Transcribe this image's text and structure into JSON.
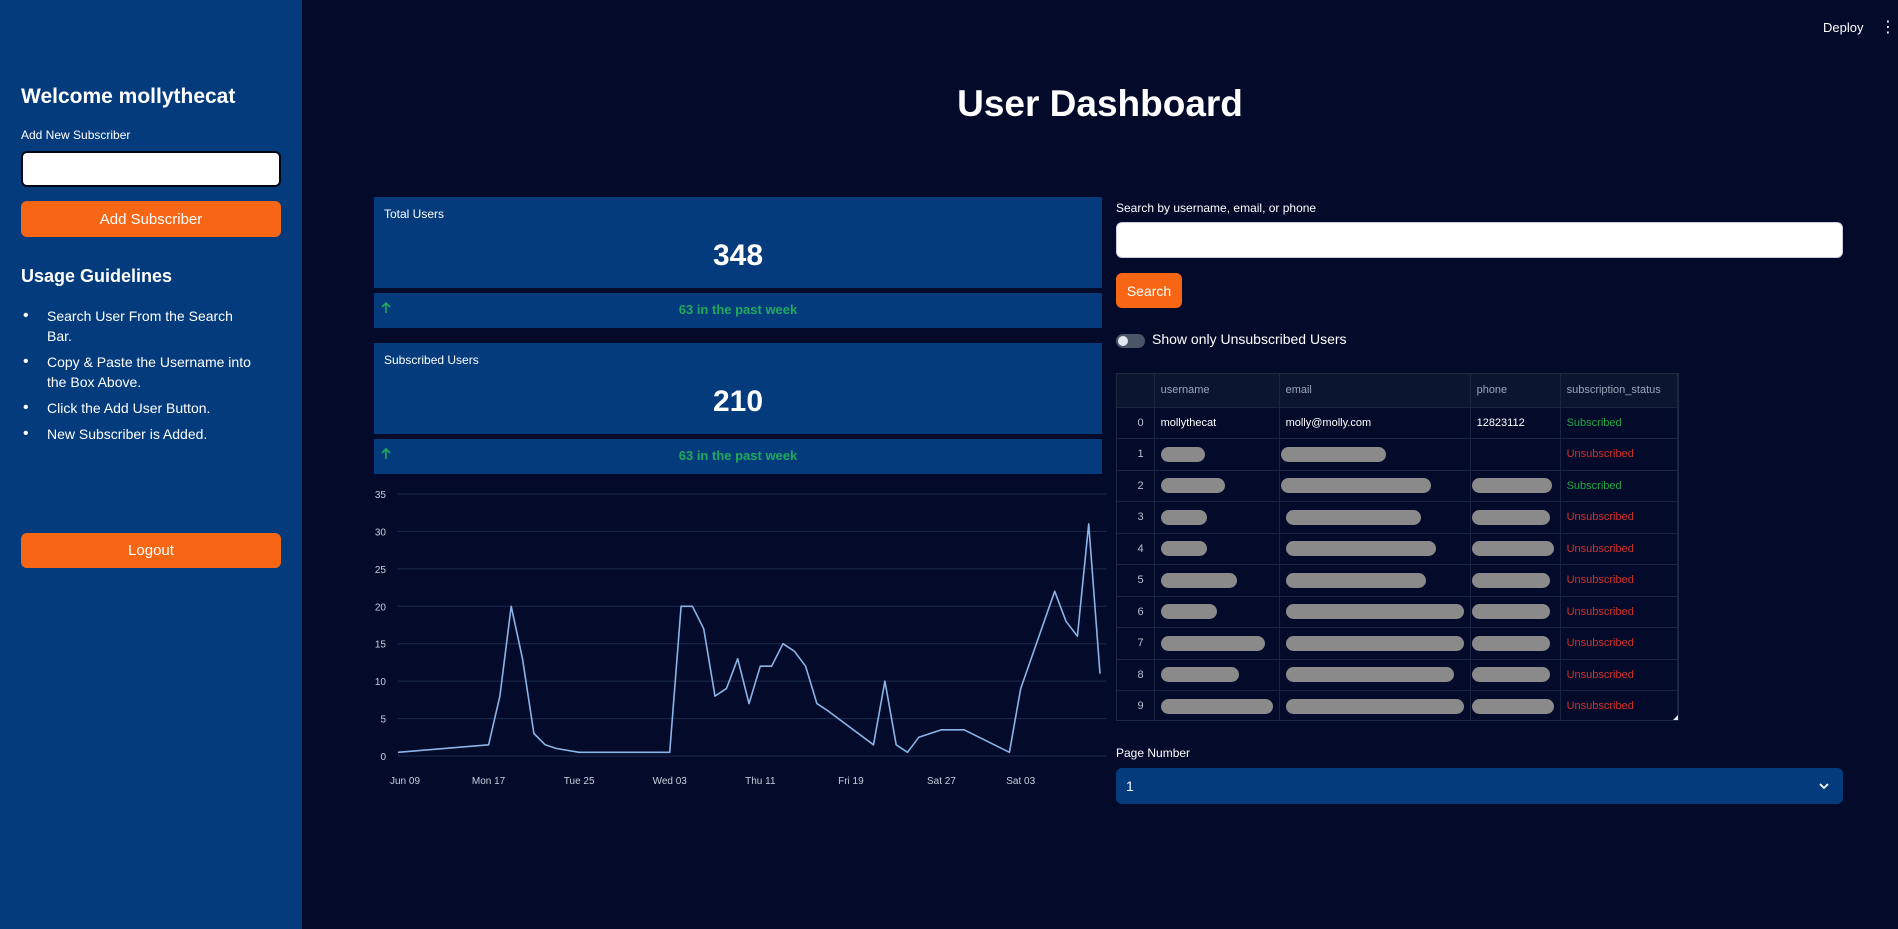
{
  "header": {
    "title": "User Dashboard",
    "deploy_label": "Deploy",
    "menu_icon": "⋮"
  },
  "sidebar": {
    "welcome": "Welcome mollythecat",
    "add_label": "Add New Subscriber",
    "add_input_value": "",
    "add_button": "Add Subscriber",
    "guidelines_title": "Usage Guidelines",
    "guidelines": [
      "Search User From the Search Bar.",
      "Copy & Paste the Username into the Box Above.",
      "Click the Add User Button.",
      "New Subscriber is Added."
    ],
    "logout_button": "Logout"
  },
  "metrics": {
    "total": {
      "label": "Total Users",
      "value": "348",
      "delta": "63 in the past week"
    },
    "subscribed": {
      "label": "Subscribed Users",
      "value": "210",
      "delta": "63 in the past week"
    }
  },
  "search": {
    "label": "Search by username, email, or phone",
    "value": "",
    "button": "Search",
    "toggle_label": "Show only Unsubscribed Users",
    "toggle_on": false
  },
  "table": {
    "columns": [
      "",
      "username",
      "email",
      "phone",
      "subscription_status"
    ],
    "rows": [
      {
        "index": "0",
        "username": "mollythecat",
        "email": "molly@molly.com",
        "phone": "12823112",
        "status": "Subscribed"
      },
      {
        "index": "1",
        "username": "",
        "email": "",
        "phone": "",
        "status": "Unsubscribed"
      },
      {
        "index": "2",
        "username": "",
        "email": "",
        "phone": "",
        "status": "Subscribed"
      },
      {
        "index": "3",
        "username": "",
        "email": "",
        "phone": "",
        "status": "Unsubscribed"
      },
      {
        "index": "4",
        "username": "",
        "email": "",
        "phone": "",
        "status": "Unsubscribed"
      },
      {
        "index": "5",
        "username": "",
        "email": "",
        "phone": "",
        "status": "Unsubscribed"
      },
      {
        "index": "6",
        "username": "",
        "email": "",
        "phone": "",
        "status": "Unsubscribed"
      },
      {
        "index": "7",
        "username": "",
        "email": "",
        "phone": "",
        "status": "Unsubscribed"
      },
      {
        "index": "8",
        "username": "",
        "email": "",
        "phone": "",
        "status": "Unsubscribed"
      },
      {
        "index": "9",
        "username": "",
        "email": "",
        "phone": "",
        "status": "Unsubscribed"
      }
    ]
  },
  "pagination": {
    "label": "Page Number",
    "value": "1"
  },
  "colors": {
    "accent": "#f76614",
    "sidebar": "#043b7c",
    "background": "#030a2a",
    "delta_green": "#22a85c",
    "line": "#8ab4e8",
    "subscribed": "#22a845",
    "unsubscribed": "#d4322c"
  },
  "chart_data": {
    "type": "line",
    "x_tick_labels": [
      "Jun 09",
      "Mon 17",
      "Tue 25",
      "Wed 03",
      "Thu 11",
      "Fri 19",
      "Sat 27",
      "Sat 03"
    ],
    "y_ticks": [
      0,
      5,
      10,
      15,
      20,
      25,
      30,
      35
    ],
    "ylim": [
      0,
      35
    ],
    "x": [
      "2024-06-09",
      "2024-06-17",
      "2024-06-18",
      "2024-06-19",
      "2024-06-20",
      "2024-06-21",
      "2024-06-22",
      "2024-06-23",
      "2024-06-25",
      "2024-07-03",
      "2024-07-04",
      "2024-07-05",
      "2024-07-06",
      "2024-07-07",
      "2024-07-08",
      "2024-07-09",
      "2024-07-10",
      "2024-07-11",
      "2024-07-12",
      "2024-07-13",
      "2024-07-14",
      "2024-07-15",
      "2024-07-16",
      "2024-07-17",
      "2024-07-21",
      "2024-07-22",
      "2024-07-23",
      "2024-07-24",
      "2024-07-25",
      "2024-07-27",
      "2024-07-29",
      "2024-08-02",
      "2024-08-03",
      "2024-08-06",
      "2024-08-07",
      "2024-08-08",
      "2024-08-09",
      "2024-08-10"
    ],
    "values": [
      0.5,
      1.5,
      8,
      20,
      13,
      3,
      1.5,
      1,
      0.5,
      0.5,
      20,
      20,
      17,
      8,
      9,
      13,
      7,
      12,
      12,
      15,
      14,
      12,
      7,
      6,
      1.5,
      10,
      1.5,
      0.5,
      2.5,
      3.5,
      3.5,
      0.5,
      9,
      22,
      18,
      16,
      31,
      11
    ],
    "grid": true
  }
}
